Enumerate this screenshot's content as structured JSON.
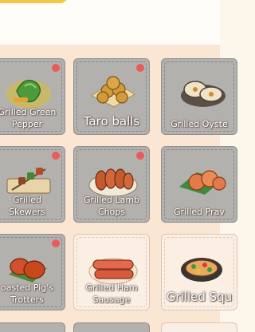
{
  "dishes": [
    {
      "name": "Grilled Green\nPepper",
      "locked": true,
      "dot": true,
      "icon": "green-pepper-icon"
    },
    {
      "name": "Taro balls",
      "locked": true,
      "dot": true,
      "icon": "taro-balls-icon"
    },
    {
      "name": "Grilled Oyste",
      "locked": true,
      "dot": false,
      "icon": "oyster-icon"
    },
    {
      "name": "Grilled\nSkewers",
      "locked": true,
      "dot": true,
      "icon": "skewers-icon"
    },
    {
      "name": "Grilled Lamb\nChops",
      "locked": true,
      "dot": true,
      "icon": "lamb-chops-icon"
    },
    {
      "name": "Grilled Prav",
      "locked": true,
      "dot": false,
      "icon": "prawns-icon"
    },
    {
      "name": "oasted Pig's\nTrotters",
      "locked": true,
      "dot": true,
      "icon": "pig-trotters-icon"
    },
    {
      "name": "Grilled Ham\nSausage",
      "locked": false,
      "dot": false,
      "icon": "ham-sausage-icon"
    },
    {
      "name": "Grilled Squ",
      "locked": false,
      "dot": false,
      "icon": "squid-icon"
    }
  ],
  "colors": {
    "locked_card": "#b3b1ae",
    "unlocked_card": "#fbefe4",
    "new_dot": "#ec5a5a",
    "accent_tab": "#f5c547"
  }
}
